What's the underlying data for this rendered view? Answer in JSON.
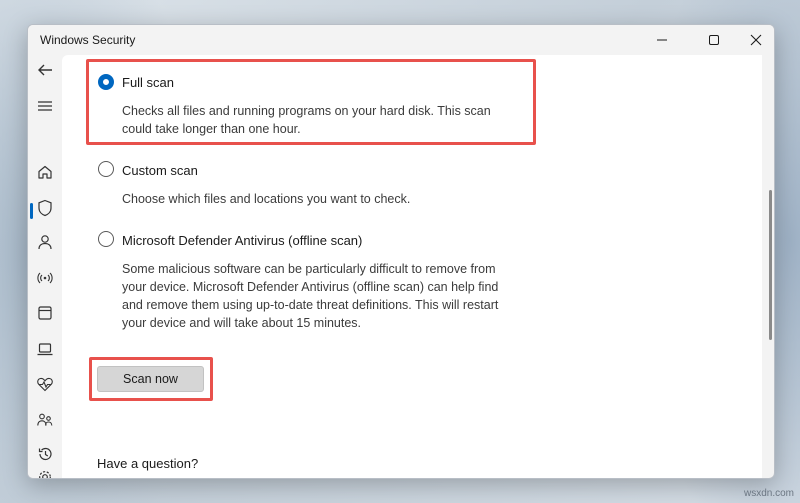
{
  "window": {
    "title": "Windows Security",
    "controls": [
      "minimize",
      "maximize",
      "close"
    ]
  },
  "sidebar": {
    "items": [
      {
        "icon": "back-arrow-icon"
      },
      {
        "icon": "hamburger-menu-icon"
      },
      {
        "icon": "home-icon"
      },
      {
        "icon": "shield-icon",
        "active": true
      },
      {
        "icon": "person-icon"
      },
      {
        "icon": "wifi-antenna-icon"
      },
      {
        "icon": "app-browser-icon"
      },
      {
        "icon": "laptop-icon"
      },
      {
        "icon": "heart-pulse-icon"
      },
      {
        "icon": "family-icon"
      },
      {
        "icon": "history-icon"
      },
      {
        "icon": "gear-icon"
      }
    ]
  },
  "scan_options": [
    {
      "label": "Full scan",
      "selected": true,
      "description_lines": [
        "Checks all files and running programs on your hard disk. This scan",
        "could take longer than one hour."
      ]
    },
    {
      "label": "Custom scan",
      "selected": false,
      "description_lines": [
        "Choose which files and locations you want to check."
      ]
    },
    {
      "label": "Microsoft Defender Antivirus (offline scan)",
      "selected": false,
      "description_lines": [
        "Some malicious software can be particularly difficult to remove from",
        "your device. Microsoft Defender Antivirus (offline scan) can help find",
        "and remove them using up-to-date threat definitions. This will restart",
        "your device and will take about 15 minutes."
      ]
    }
  ],
  "scan_button": {
    "label": "Scan now"
  },
  "footer": {
    "question": "Have a question?"
  },
  "watermark": "wsxdn.com",
  "colors": {
    "accent": "#0067c0",
    "highlight": "#e8514c",
    "button_bg": "#d6d6d6"
  }
}
